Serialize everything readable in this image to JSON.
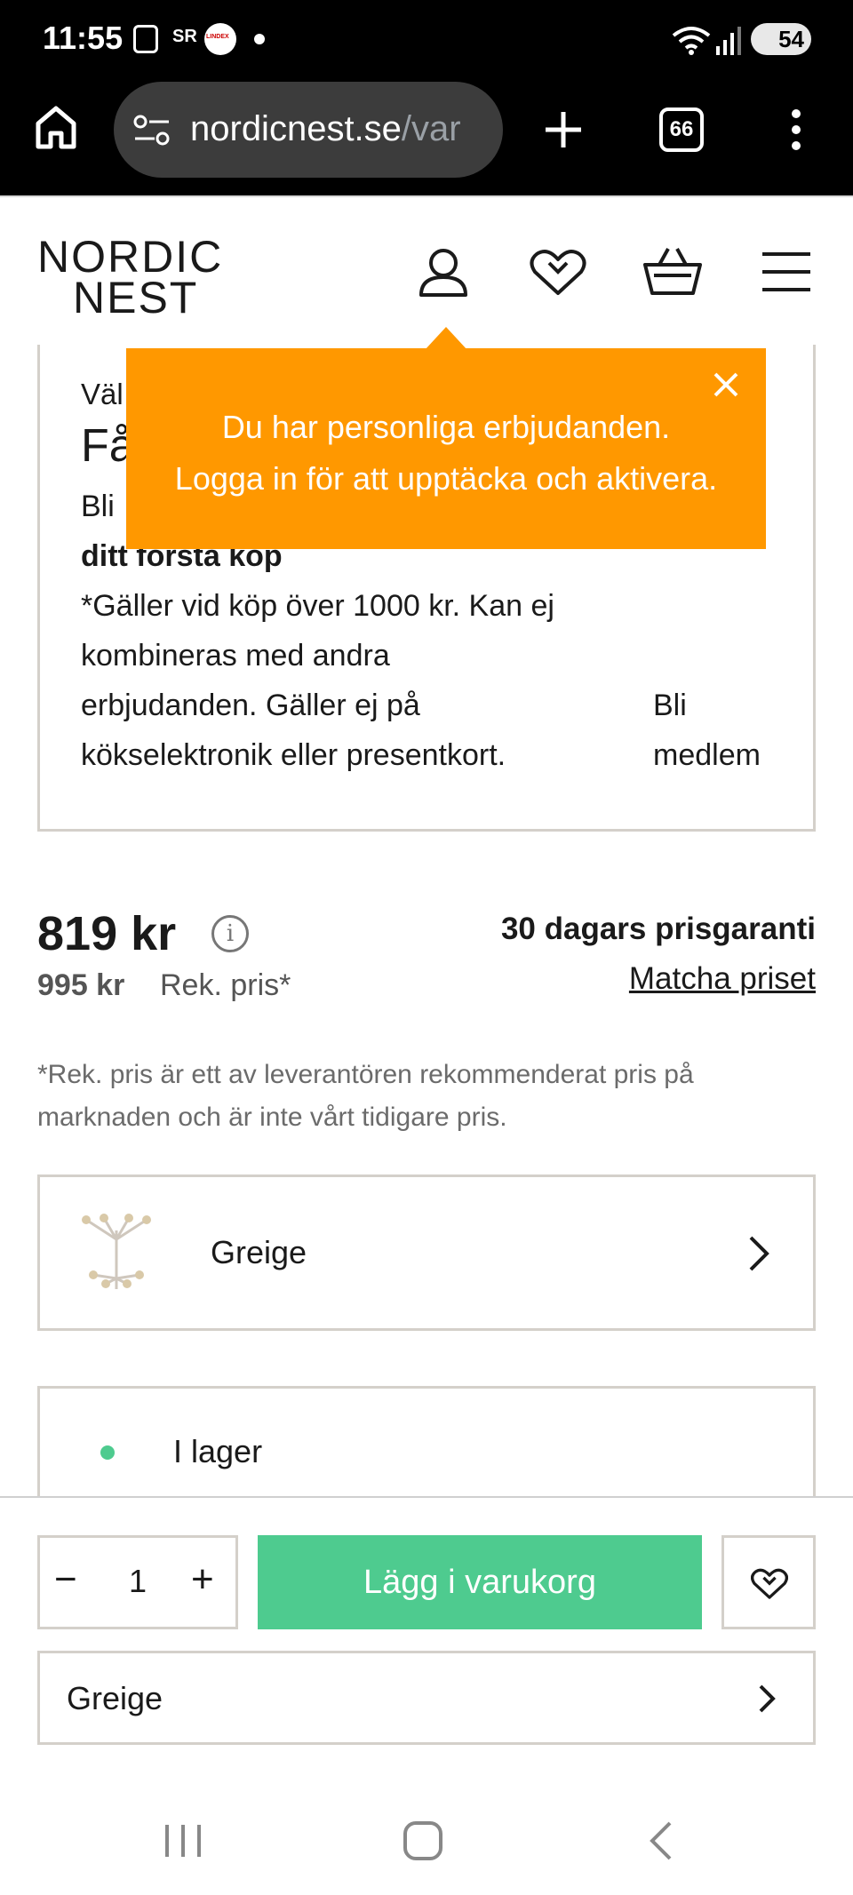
{
  "status_bar": {
    "time": "11:55",
    "battery": "54",
    "app_badge": "LINDEX",
    "icons": [
      "screenshot-icon",
      "sr-icon",
      "lindex-icon",
      "notification-dot",
      "wifi-icon",
      "signal-icon",
      "battery-icon"
    ]
  },
  "browser": {
    "url_main": "nordicnest.se",
    "url_rest": "/var",
    "tab_count": "66"
  },
  "header": {
    "logo_line1": "NORDIC",
    "logo_line2": "NEST"
  },
  "member_card": {
    "line_welcome": "Väl",
    "line_heading": "Få",
    "line_bli": "Bli",
    "line_first_purchase": "ditt första köp",
    "terms_1": "*Gäller vid köp över 1000 kr. Kan ej",
    "terms_2": "kombineras med andra",
    "terms_3": "erbjudanden. Gäller ej på",
    "terms_4": "kökselektronik eller presentkort.",
    "cta_1": "Bli",
    "cta_2": "medlem"
  },
  "popup": {
    "line1": "Du har personliga erbjudanden.",
    "line2": "Logga in för att upptäcka och aktivera."
  },
  "price": {
    "current": "819 kr",
    "info_icon": "i",
    "old": "995 kr",
    "rek_label": "Rek. pris*",
    "guarantee": "30 dagars prisgaranti",
    "match_link": "Matcha priset",
    "disclaimer": "*Rek. pris är ett av leverantören rekommenderat pris på marknaden och är inte vårt tidigare pris."
  },
  "variant": {
    "name": "Greige"
  },
  "stock": {
    "label": "I lager",
    "color": "#4ecb8f"
  },
  "sticky": {
    "qty_minus": "−",
    "qty_value": "1",
    "qty_plus": "+",
    "add_to_cart": "Lägg i varukorg",
    "variant_name": "Greige"
  },
  "colors": {
    "accent_orange": "#ff9800",
    "accent_green": "#4ecb8f",
    "border": "#d4d0ca"
  }
}
